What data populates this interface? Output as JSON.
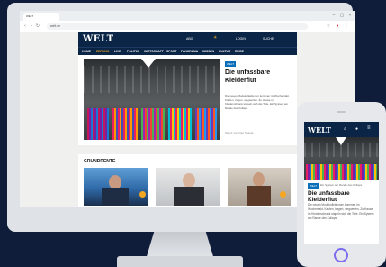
{
  "browser": {
    "tab_title": "WELT",
    "url": "welt.de",
    "nav_icons": [
      "back-icon",
      "forward-icon",
      "reload-icon",
      "home-icon"
    ]
  },
  "site": {
    "logo": "WELT",
    "header_links": [
      "ABO",
      "LOGIN",
      "SUCHE"
    ],
    "nav_items": [
      "HOME",
      "ZEITUNG",
      "LIVE",
      "POLITIK",
      "WIRTSCHAFT",
      "SPORT",
      "PANORAMA",
      "WISSEN",
      "KULTUR",
      "REISE"
    ],
    "active_nav_index": 1,
    "hero": {
      "badge": "WELT",
      "title": "Die unfassbare Kleiderflut",
      "teaser": "Die neuen Modekollektionen kommen im Wochentakt. Kaufen, tragen, wegwerfen. Zu Hause im Kleiderschrank stapeln sich die Teile. Ein System am Rande des Kollaps.",
      "meta": "Stand: vor einer Stunde"
    },
    "section_title": "GRUNDRENTE"
  },
  "phone": {
    "logo": "WELT",
    "badge": "WELT",
    "kicker": "Ein System am Rande des Kollaps",
    "title": "Die unfassbare Kleiderflut",
    "teaser": "Die neuen Modekollektionen kommen im Wochentakt. Kaufen, tragen, wegwerfen. Zu Hause im Kleiderschrank stapeln sich die Teile. Ein System am Rande des Kollaps."
  },
  "colors": {
    "brand_navy": "#0a2546",
    "accent_orange": "#f5a623",
    "badge_blue": "#0a6fb8"
  }
}
